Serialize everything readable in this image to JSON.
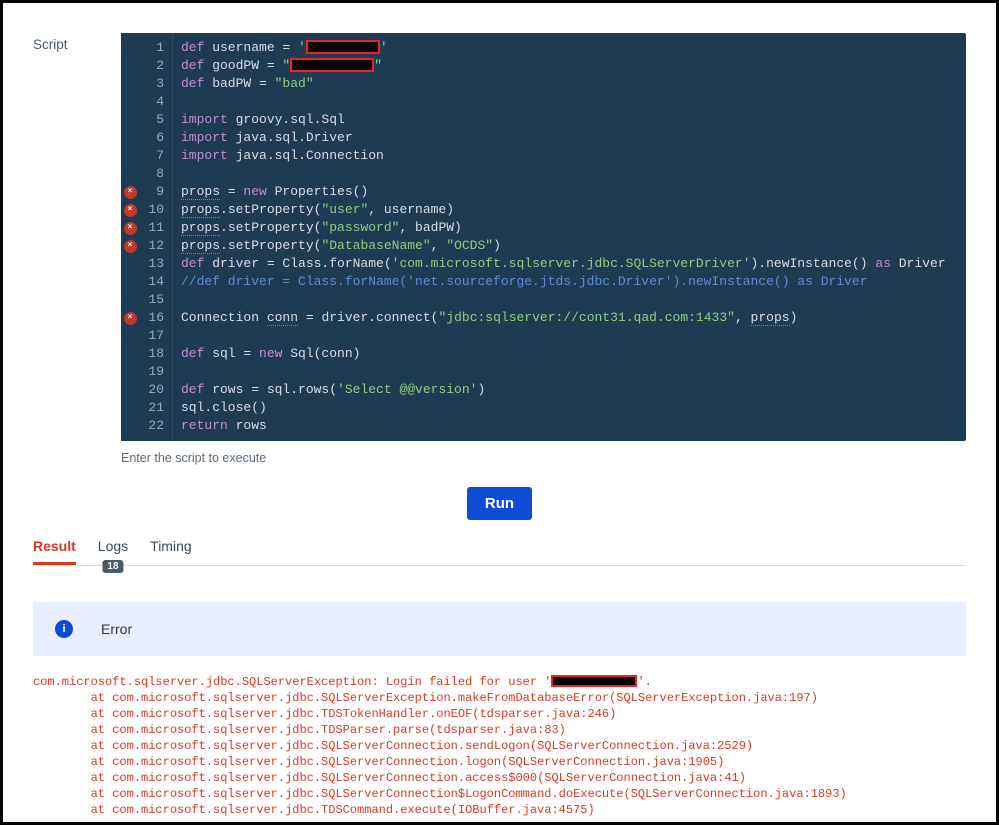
{
  "label": "Script",
  "helper": "Enter the script to execute",
  "run_label": "Run",
  "tabs": {
    "result": "Result",
    "logs": "Logs",
    "timing": "Timing",
    "logs_badge": "18"
  },
  "error_banner": "Error",
  "editor": {
    "error_lines": [
      9,
      10,
      11,
      12,
      16
    ],
    "lines": [
      {
        "n": 1,
        "tokens": [
          [
            "kw",
            "def"
          ],
          [
            "",
            " username = "
          ],
          [
            "str",
            "'"
          ],
          [
            "redbox",
            ""
          ],
          [
            "str",
            "'"
          ]
        ]
      },
      {
        "n": 2,
        "tokens": [
          [
            "kw",
            "def"
          ],
          [
            "",
            " goodPW = "
          ],
          [
            "str",
            "\""
          ],
          [
            "redbox-w",
            ""
          ],
          [
            "str",
            "\""
          ]
        ]
      },
      {
        "n": 3,
        "tokens": [
          [
            "kw",
            "def"
          ],
          [
            "",
            " badPW = "
          ],
          [
            "str",
            "\"bad\""
          ]
        ]
      },
      {
        "n": 4,
        "tokens": [
          [
            "",
            ""
          ]
        ]
      },
      {
        "n": 5,
        "tokens": [
          [
            "kw",
            "import"
          ],
          [
            "",
            " groovy.sql.Sql"
          ]
        ]
      },
      {
        "n": 6,
        "tokens": [
          [
            "kw",
            "import"
          ],
          [
            "",
            " java.sql.Driver"
          ]
        ]
      },
      {
        "n": 7,
        "tokens": [
          [
            "kw",
            "import"
          ],
          [
            "",
            " java.sql.Connection"
          ]
        ]
      },
      {
        "n": 8,
        "tokens": [
          [
            "",
            ""
          ]
        ]
      },
      {
        "n": 9,
        "tokens": [
          [
            "squig",
            "props"
          ],
          [
            "",
            " = "
          ],
          [
            "kw",
            "new"
          ],
          [
            "",
            " Properties()"
          ]
        ]
      },
      {
        "n": 10,
        "tokens": [
          [
            "squig",
            "props"
          ],
          [
            "",
            ".setProperty("
          ],
          [
            "str",
            "\"user\""
          ],
          [
            "",
            ", username)"
          ]
        ]
      },
      {
        "n": 11,
        "tokens": [
          [
            "squig",
            "props"
          ],
          [
            "",
            ".setProperty("
          ],
          [
            "str",
            "\"password\""
          ],
          [
            "",
            ", badPW)"
          ]
        ]
      },
      {
        "n": 12,
        "tokens": [
          [
            "squig",
            "props"
          ],
          [
            "",
            ".setProperty("
          ],
          [
            "str",
            "\"DatabaseName\""
          ],
          [
            "",
            ", "
          ],
          [
            "str",
            "\"OCDS\""
          ],
          [
            "",
            ")"
          ]
        ]
      },
      {
        "n": 13,
        "tokens": [
          [
            "kw",
            "def"
          ],
          [
            "",
            " driver = Class.forName("
          ],
          [
            "str",
            "'com.microsoft.sqlserver.jdbc.SQLServerDriver'"
          ],
          [
            "",
            ").newInstance() "
          ],
          [
            "kw",
            "as"
          ],
          [
            "",
            " Driver"
          ]
        ]
      },
      {
        "n": 14,
        "tokens": [
          [
            "cmt",
            "//def driver = Class.forName('net.sourceforge.jtds.jdbc.Driver').newInstance() as Driver"
          ]
        ]
      },
      {
        "n": 15,
        "tokens": [
          [
            "",
            ""
          ]
        ]
      },
      {
        "n": 16,
        "tokens": [
          [
            "",
            "Connection "
          ],
          [
            "squig",
            "conn"
          ],
          [
            "",
            " = driver.connect("
          ],
          [
            "str",
            "\"jdbc:sqlserver://cont31.qad.com:1433\""
          ],
          [
            "",
            ", "
          ],
          [
            "squig",
            "props"
          ],
          [
            "",
            ")"
          ]
        ]
      },
      {
        "n": 17,
        "tokens": [
          [
            "",
            ""
          ]
        ]
      },
      {
        "n": 18,
        "tokens": [
          [
            "kw",
            "def"
          ],
          [
            "",
            " sql = "
          ],
          [
            "kw",
            "new"
          ],
          [
            "",
            " Sql(conn)"
          ]
        ]
      },
      {
        "n": 19,
        "tokens": [
          [
            "",
            ""
          ]
        ]
      },
      {
        "n": 20,
        "tokens": [
          [
            "kw",
            "def"
          ],
          [
            "",
            " rows = sql.rows("
          ],
          [
            "str",
            "'Select @@version'"
          ],
          [
            "",
            ")"
          ]
        ]
      },
      {
        "n": 21,
        "tokens": [
          [
            "",
            "sql.close()"
          ]
        ]
      },
      {
        "n": 22,
        "tokens": [
          [
            "kw",
            "return"
          ],
          [
            "",
            " rows"
          ]
        ]
      }
    ]
  },
  "stack": {
    "head_pre": "com.microsoft.sqlserver.jdbc.SQLServerException: Login failed for user '",
    "head_post": "'.",
    "frames": [
      "        at com.microsoft.sqlserver.jdbc.SQLServerException.makeFromDatabaseError(SQLServerException.java:197)",
      "        at com.microsoft.sqlserver.jdbc.TDSTokenHandler.onEOF(tdsparser.java:246)",
      "        at com.microsoft.sqlserver.jdbc.TDSParser.parse(tdsparser.java:83)",
      "        at com.microsoft.sqlserver.jdbc.SQLServerConnection.sendLogon(SQLServerConnection.java:2529)",
      "        at com.microsoft.sqlserver.jdbc.SQLServerConnection.logon(SQLServerConnection.java:1905)",
      "        at com.microsoft.sqlserver.jdbc.SQLServerConnection.access$000(SQLServerConnection.java:41)",
      "        at com.microsoft.sqlserver.jdbc.SQLServerConnection$LogonCommand.doExecute(SQLServerConnection.java:1893)",
      "        at com.microsoft.sqlserver.jdbc.TDSCommand.execute(IOBuffer.java:4575)"
    ]
  }
}
